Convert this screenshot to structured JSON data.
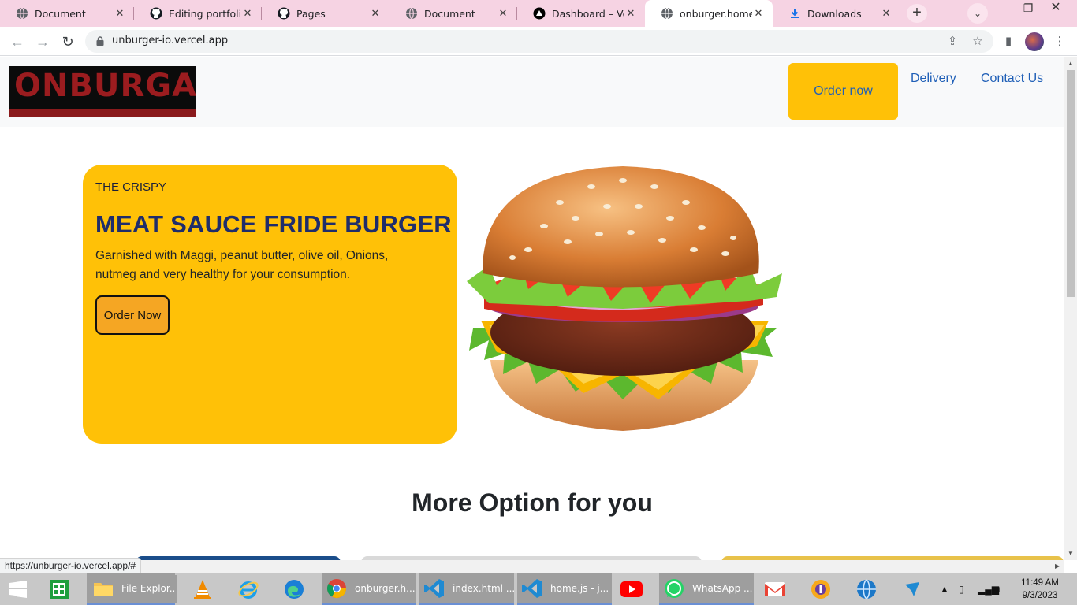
{
  "browser": {
    "tabs": [
      {
        "title": "Document",
        "icon": "globe-icon",
        "active": false
      },
      {
        "title": "Editing portfolio.g",
        "icon": "github-icon",
        "active": false
      },
      {
        "title": "Pages",
        "icon": "github-icon",
        "active": false
      },
      {
        "title": "Document",
        "icon": "globe-icon",
        "active": false
      },
      {
        "title": "Dashboard – Verce",
        "icon": "vercel-icon",
        "active": false
      },
      {
        "title": "onburger.home",
        "icon": "globe-icon",
        "active": true
      },
      {
        "title": "Downloads",
        "icon": "download-icon",
        "active": false
      }
    ],
    "close_glyph": "✕",
    "url": "unburger-io.vercel.app",
    "status_url": "https://unburger-io.vercel.app/#",
    "tab_strip_color": "#f6d3e3"
  },
  "site": {
    "logo_text": "ONBURGA",
    "nav": {
      "order_label": "Order now",
      "delivery_label": "Delivery",
      "contact_label": "Contact Us"
    },
    "hero": {
      "eyebrow": "THE CRISPY",
      "title": "MEAT SAUCE FRIDE BURGER",
      "description": "Garnished with Maggi, peanut butter, olive oil, Onions, nutmeg and very healthy for your consumption.",
      "button_label": "Order Now"
    },
    "section_title": "More Option for you",
    "colors": {
      "accent": "#ffc107",
      "link": "#1f5fb7",
      "title": "#1f2d6b",
      "logo_text": "#9b1c1f"
    }
  },
  "taskbar": {
    "items": [
      {
        "label": "",
        "icon": "windows-start-icon"
      },
      {
        "label": "",
        "icon": "excel-icon"
      },
      {
        "label": "File Explor...",
        "icon": "file-explorer-icon"
      },
      {
        "label": "",
        "icon": "vlc-icon"
      },
      {
        "label": "",
        "icon": "internet-explorer-icon"
      },
      {
        "label": "",
        "icon": "edge-icon"
      },
      {
        "label": "onburger.h...",
        "icon": "chrome-icon"
      },
      {
        "label": "index.html ...",
        "icon": "vscode-icon"
      },
      {
        "label": "home.js - j...",
        "icon": "vscode-icon"
      },
      {
        "label": "",
        "icon": "youtube-icon"
      },
      {
        "label": "WhatsApp ...",
        "icon": "whatsapp-icon"
      },
      {
        "label": "",
        "icon": "gmail-icon"
      },
      {
        "label": "",
        "icon": "vpn-icon"
      },
      {
        "label": "",
        "icon": "globe-app-icon"
      },
      {
        "label": "",
        "icon": "arrow-app-icon"
      }
    ],
    "time": "11:49 AM",
    "date": "9/3/2023"
  }
}
